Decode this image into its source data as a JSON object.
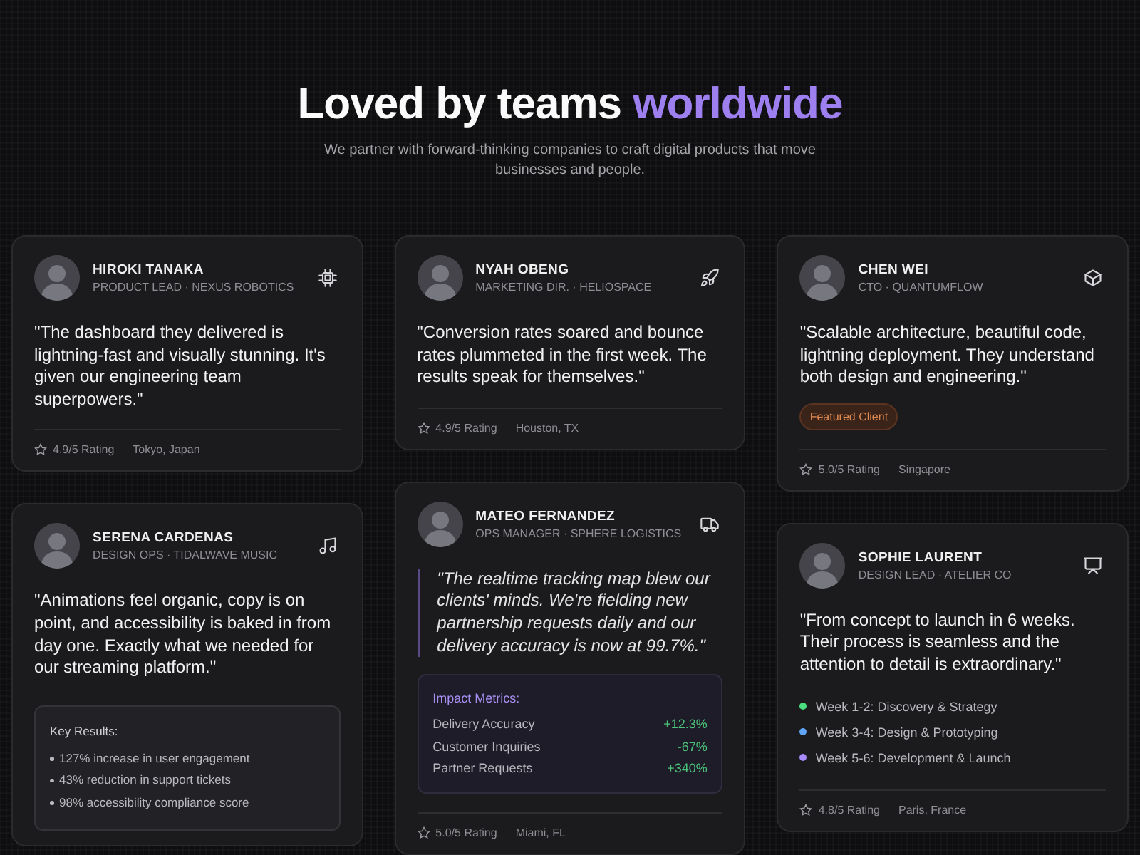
{
  "header": {
    "title_lead": "Loved by teams",
    "title_highlight": "worldwide",
    "subtitle": "We partner with forward-thinking companies to craft digital products that move businesses and people."
  },
  "columns": [
    {
      "cards": [
        {
          "name": "HIROKI TANAKA",
          "role": "PRODUCT LEAD · NEXUS ROBOTICS",
          "quote": "\"The dashboard they delivered is lightning-fast and visually stunning. It's given our engineering team superpowers.\"",
          "emphasized": false,
          "extra": {
            "kind": "none"
          },
          "rating": "4.9/5 Rating",
          "location": "Tokyo, Japan"
        },
        {
          "name": "SERENA CARDENAS",
          "role": "DESIGN OPS · TIDALWAVE MUSIC",
          "quote": "\"Animations feel organic, copy is on point, and accessibility is baked in from day one. Exactly what we needed for our streaming platform.\"",
          "emphasized": false,
          "extra": {
            "kind": "results",
            "title": "Key Results:",
            "items": [
              "127% increase in user engagement",
              "43% reduction in support tickets",
              "98% accessibility compliance score"
            ]
          }
        }
      ]
    },
    {
      "cards": [
        {
          "name": "NYAH OBENG",
          "role": "MARKETING DIR. · HELIOSPACE",
          "quote": "\"Conversion rates soared and bounce rates plummeted in the first week. The results speak for themselves.\"",
          "emphasized": false,
          "extra": {
            "kind": "none"
          },
          "rating": "4.9/5 Rating",
          "location": "Houston, TX"
        },
        {
          "name": "MATEO FERNANDEZ",
          "role": "OPS MANAGER · SPHERE LOGISTICS",
          "quote": "\"The realtime tracking map blew our clients' minds. We're fielding new partnership requests daily and our delivery accuracy is now at 99.7%.\"",
          "emphasized": true,
          "extra": {
            "kind": "metrics",
            "title": "Impact Metrics:",
            "rows": [
              {
                "label": "Delivery Accuracy",
                "value": "+12.3%"
              },
              {
                "label": "Customer Inquiries",
                "value": "-67%"
              },
              {
                "label": "Partner Requests",
                "value": "+340%"
              }
            ]
          },
          "rating": "5.0/5 Rating",
          "location": "Miami, FL"
        }
      ]
    },
    {
      "cards": [
        {
          "name": "CHEN WEI",
          "role": "CTO · QUANTUMFLOW",
          "quote": "\"Scalable architecture, beautiful code, lightning deployment. They understand both design and engineering.\"",
          "emphasized": false,
          "extra": {
            "kind": "badge",
            "label": "Featured Client"
          },
          "rating": "5.0/5 Rating",
          "location": "Singapore"
        },
        {
          "name": "SOPHIE LAURENT",
          "role": "DESIGN LEAD · ATELIER CO",
          "quote": "\"From concept to launch in 6 weeks. Their process is seamless and the attention to detail is extraordinary.\"",
          "emphasized": false,
          "extra": {
            "kind": "timeline",
            "steps": [
              {
                "label": "Week 1-2: Discovery & Strategy",
                "color": "#4ade80"
              },
              {
                "label": "Week 3-4: Design & Prototyping",
                "color": "#60a5fa"
              },
              {
                "label": "Week 5-6: Development & Launch",
                "color": "#a78bfa"
              }
            ]
          },
          "rating": "4.8/5 Rating",
          "location": "Paris, France"
        }
      ]
    }
  ]
}
